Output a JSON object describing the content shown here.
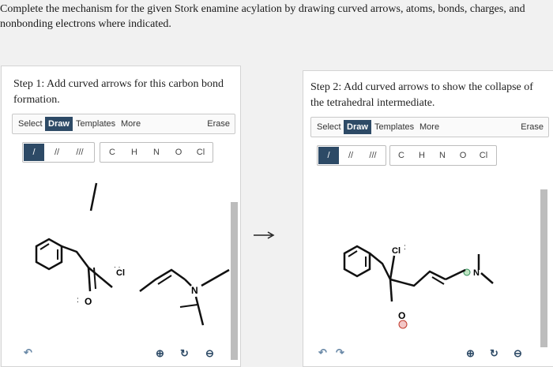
{
  "question": "Complete the mechanism for the given Stork enamine acylation by drawing curved arrows, atoms, bonds, charges, and nonbonding electrons where indicated.",
  "step1": {
    "title": "Step 1: Add curved arrows for this carbon bond formation.",
    "menu": {
      "select": "Select",
      "draw": "Draw",
      "templates": "Templates",
      "more": "More",
      "erase": "Erase"
    },
    "tools": {
      "single": "/",
      "double": "//",
      "triple": "///",
      "atoms": [
        "C",
        "H",
        "N",
        "O",
        "Cl"
      ]
    },
    "molecule_labels": {
      "cl": "Cl",
      "n": "N",
      "o": "O"
    }
  },
  "step2": {
    "title": "Step 2: Add curved arrows to show the collapse of the tetrahedral intermediate.",
    "menu": {
      "select": "Select",
      "draw": "Draw",
      "templates": "Templates",
      "more": "More",
      "erase": "Erase"
    },
    "tools": {
      "single": "/",
      "double": "//",
      "triple": "///",
      "atoms": [
        "C",
        "H",
        "N",
        "O",
        "Cl"
      ]
    },
    "molecule_labels": {
      "cl": "Cl",
      "n": "N",
      "o": "O"
    }
  },
  "colors": {
    "accent": "#2d4a66",
    "panel_bg": "#ffffff",
    "page_bg": "#f1f1f1",
    "charge": "#c0392b"
  },
  "icons": [
    "zoom-in-icon",
    "reset-icon",
    "zoom-out-icon",
    "undo-icon",
    "redo-icon",
    "reaction-arrow-icon"
  ]
}
